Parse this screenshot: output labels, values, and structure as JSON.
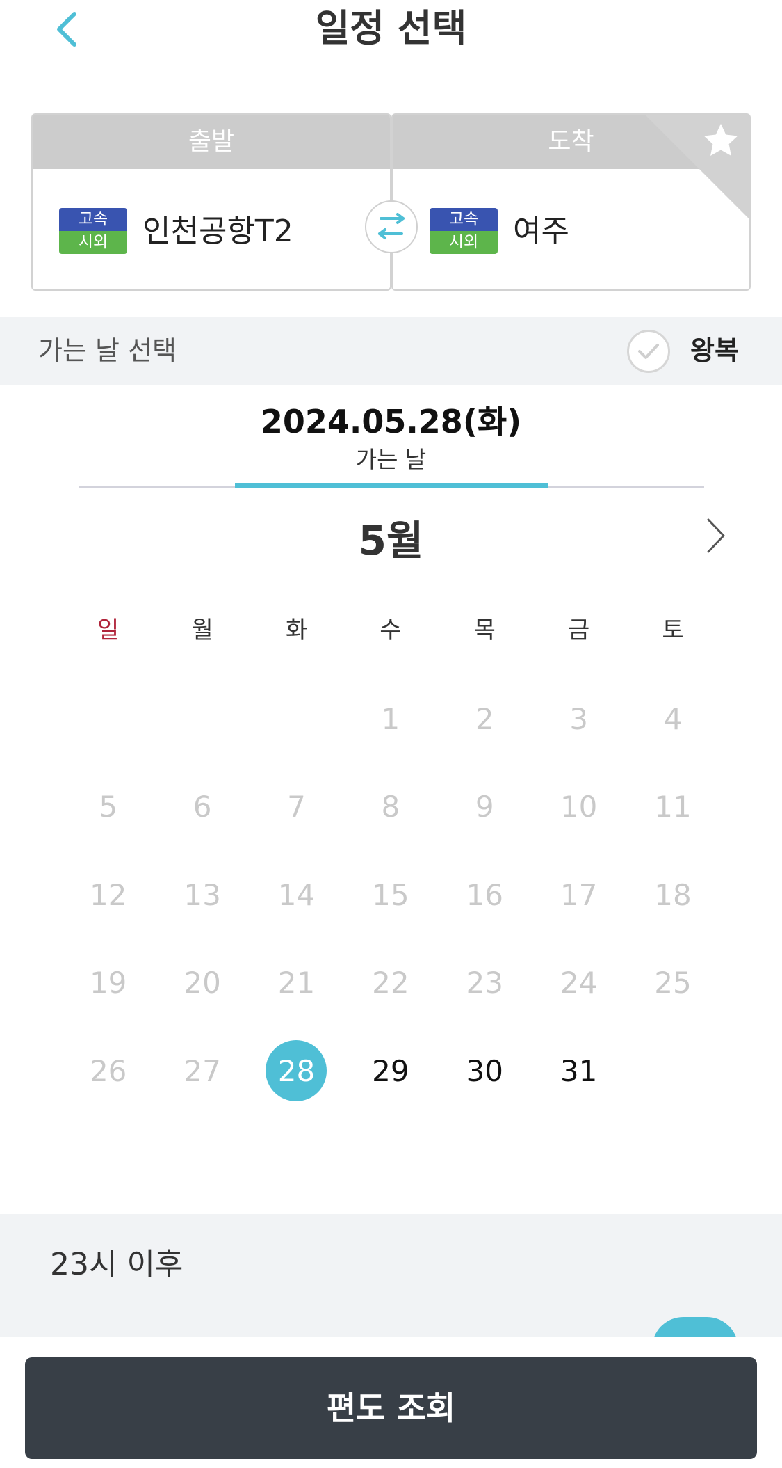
{
  "header": {
    "title": "일정 선택",
    "back_icon": "chevron-left-icon"
  },
  "route": {
    "departure": {
      "header": "출발",
      "badge_top": "고속",
      "badge_bottom": "시외",
      "station": "인천공항T2"
    },
    "arrival": {
      "header": "도착",
      "badge_top": "고속",
      "badge_bottom": "시외",
      "station": "여주"
    },
    "swap_icon": "swap-arrows-icon",
    "favorite_icon": "star-icon"
  },
  "date_select": {
    "label": "가는 날 선택",
    "roundtrip_label": "왕복",
    "roundtrip_checked": false
  },
  "selected": {
    "date": "2024.05.28(화)",
    "label": "가는 날"
  },
  "calendar": {
    "month": "5월",
    "weekdays": [
      "일",
      "월",
      "화",
      "수",
      "목",
      "금",
      "토"
    ],
    "selected_day": "28"
  },
  "time": {
    "label": "23시 이후"
  },
  "footer": {
    "submit_label": "편도 조회"
  },
  "colors": {
    "accent": "#4fbfd6",
    "badge_express": "#3954b0",
    "badge_intercity": "#5db54b",
    "sunday": "#b0243a",
    "button_bg": "#383f47"
  }
}
